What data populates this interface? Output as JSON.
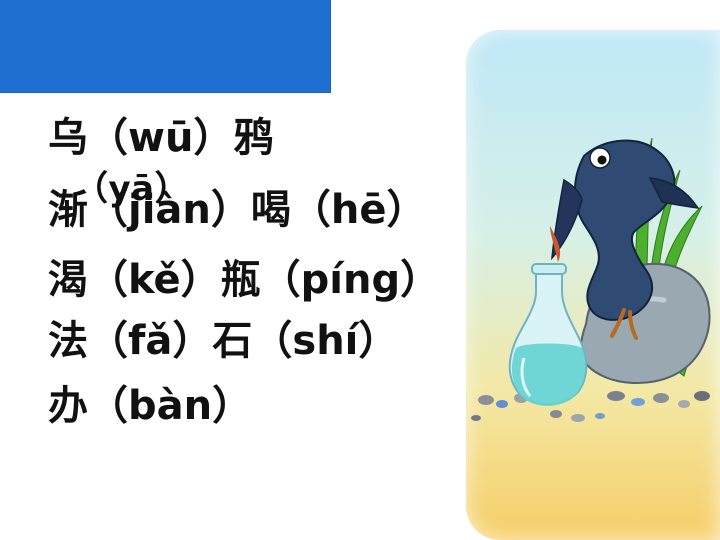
{
  "header": {
    "bar_color": "#1f6fd1"
  },
  "lines": [
    {
      "text": "乌（wū）鸦"
    },
    {
      "text": "（yā）"
    },
    {
      "text": "渐（jiàn）喝（hē）"
    },
    {
      "text": "渴（kě）瓶（píng）"
    },
    {
      "text": "法（fǎ）石（shí）"
    },
    {
      "text": "办（bàn）"
    }
  ],
  "illustration": {
    "icons": [
      "crow-icon",
      "bottle-icon",
      "rock-icon",
      "grass-icon",
      "pebbles-icon"
    ]
  }
}
